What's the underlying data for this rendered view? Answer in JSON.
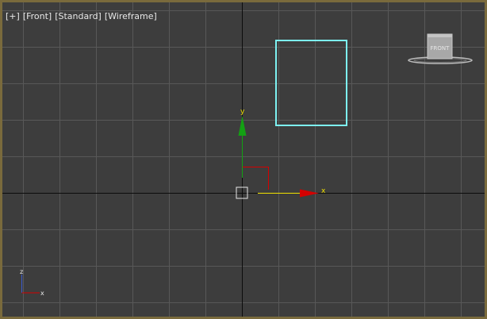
{
  "viewport": {
    "menu": {
      "plus_label": "[+]",
      "view_label": "[Front]",
      "shading_label": "[Standard]",
      "display_label": "[Wireframe]"
    },
    "gizmo": {
      "x_label": "x",
      "y_label": "y"
    },
    "view_cube": {
      "face_label": "FRONT"
    },
    "axis_tripod": {
      "x_label": "x",
      "z_label": "z"
    },
    "colors": {
      "background": "#3d3d3d",
      "grid": "#585858",
      "origin_axis": "#0c0c0c",
      "frame": "#7a6a3c",
      "selected_object": "#7df2f2",
      "gizmo_x": "#d40000",
      "gizmo_y": "#13a113",
      "gizmo_x_active": "#f0e000"
    }
  }
}
